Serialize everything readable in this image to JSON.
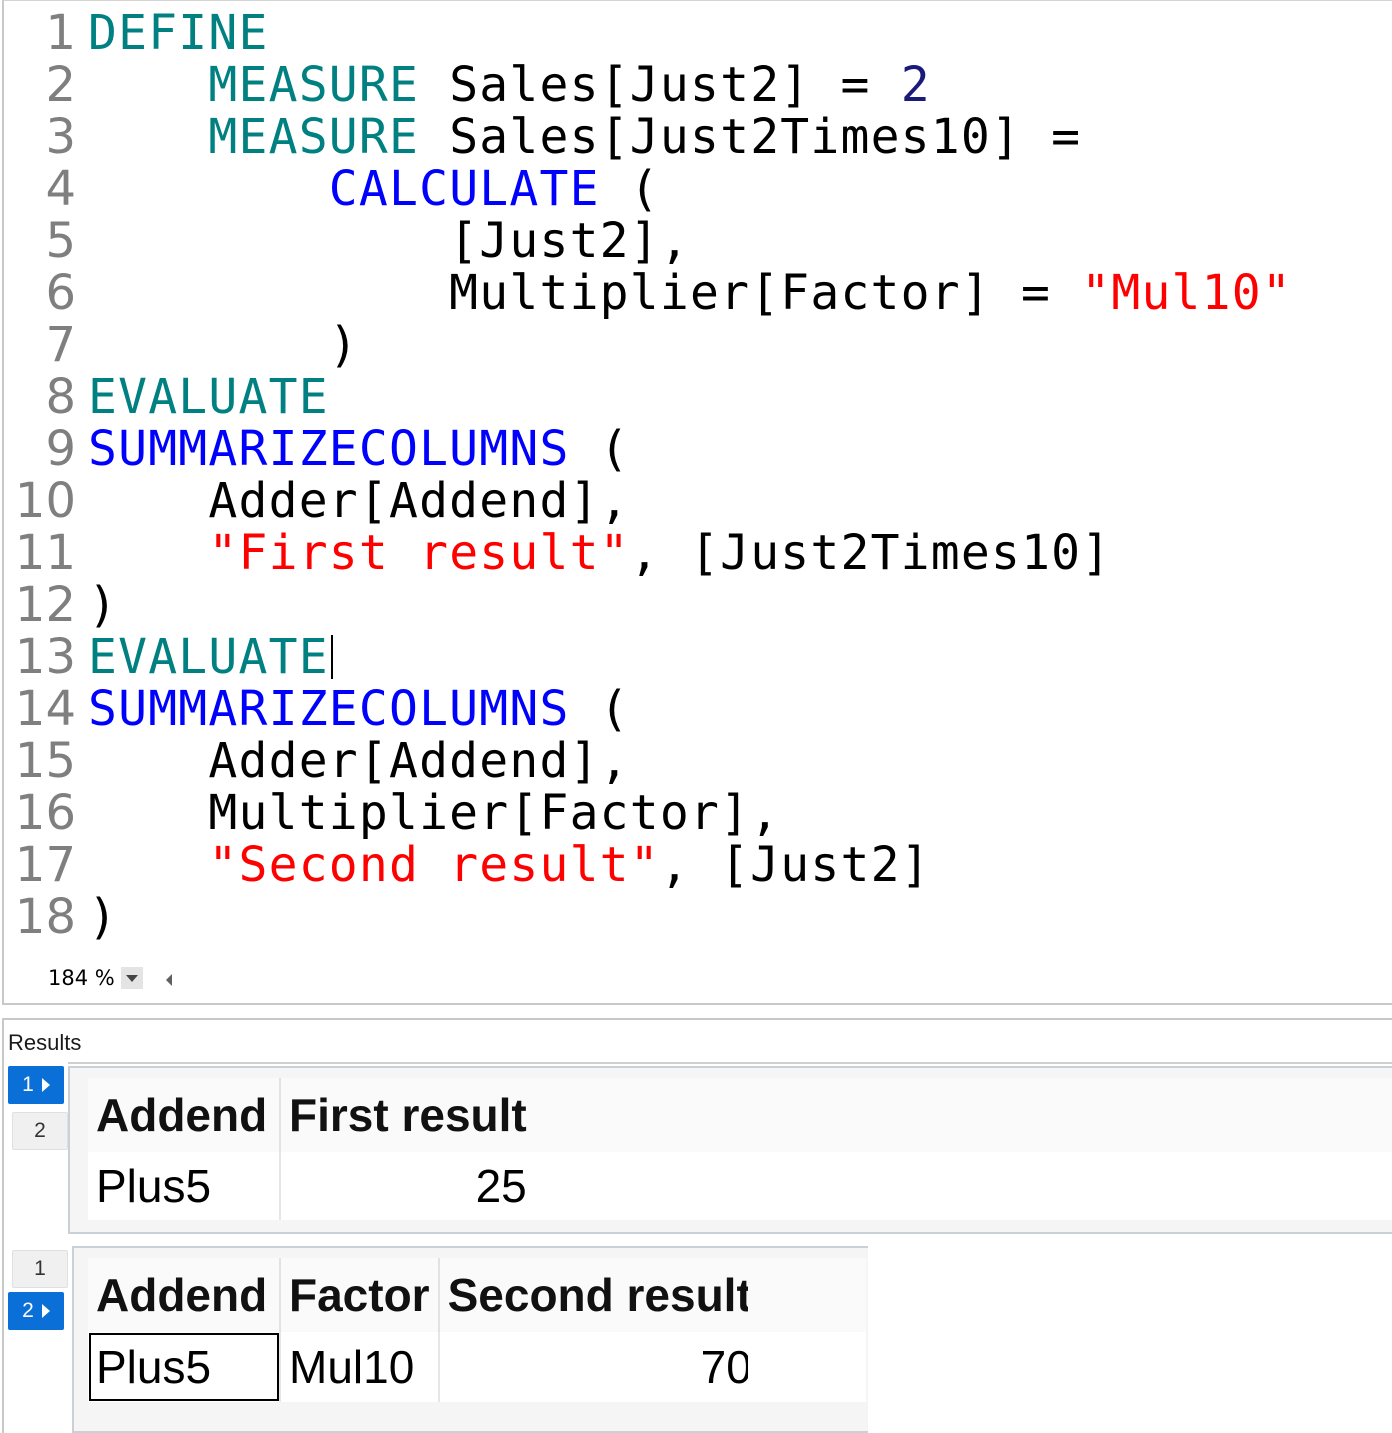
{
  "editor": {
    "lines": [
      {
        "n": "1",
        "tokens": [
          {
            "t": "DEFINE",
            "c": "kw-teal"
          }
        ]
      },
      {
        "n": "2",
        "tokens": [
          {
            "t": "    "
          },
          {
            "t": "MEASURE",
            "c": "kw-teal"
          },
          {
            "t": " Sales[Just2] = "
          },
          {
            "t": "2",
            "c": "num"
          }
        ]
      },
      {
        "n": "3",
        "tokens": [
          {
            "t": "    "
          },
          {
            "t": "MEASURE",
            "c": "kw-teal"
          },
          {
            "t": " Sales[Just2Times10] ="
          }
        ]
      },
      {
        "n": "4",
        "tokens": [
          {
            "t": "        "
          },
          {
            "t": "CALCULATE",
            "c": "kw-blue"
          },
          {
            "t": " ("
          }
        ]
      },
      {
        "n": "5",
        "tokens": [
          {
            "t": "            [Just2],"
          }
        ]
      },
      {
        "n": "6",
        "tokens": [
          {
            "t": "            Multiplier[Factor] = "
          },
          {
            "t": "\"Mul10\"",
            "c": "str"
          }
        ]
      },
      {
        "n": "7",
        "tokens": [
          {
            "t": "        )"
          }
        ]
      },
      {
        "n": "8",
        "tokens": [
          {
            "t": "EVALUATE",
            "c": "kw-teal"
          }
        ]
      },
      {
        "n": "9",
        "tokens": [
          {
            "t": "SUMMARIZECOLUMNS",
            "c": "kw-blue"
          },
          {
            "t": " ("
          }
        ]
      },
      {
        "n": "10",
        "tokens": [
          {
            "t": "    Adder[Addend],"
          }
        ]
      },
      {
        "n": "11",
        "tokens": [
          {
            "t": "    "
          },
          {
            "t": "\"First result\"",
            "c": "str"
          },
          {
            "t": ", [Just2Times10]"
          }
        ]
      },
      {
        "n": "12",
        "tokens": [
          {
            "t": ")"
          }
        ]
      },
      {
        "n": "13",
        "tokens": [
          {
            "t": "EVALUATE",
            "c": "kw-teal"
          }
        ],
        "caret": true
      },
      {
        "n": "14",
        "tokens": [
          {
            "t": "SUMMARIZECOLUMNS",
            "c": "kw-blue"
          },
          {
            "t": " ("
          }
        ]
      },
      {
        "n": "15",
        "tokens": [
          {
            "t": "    Adder[Addend],"
          }
        ]
      },
      {
        "n": "16",
        "tokens": [
          {
            "t": "    Multiplier[Factor],"
          }
        ]
      },
      {
        "n": "17",
        "tokens": [
          {
            "t": "    "
          },
          {
            "t": "\"Second result\"",
            "c": "str"
          },
          {
            "t": ", [Just2]"
          }
        ]
      },
      {
        "n": "18",
        "tokens": [
          {
            "t": ")"
          }
        ]
      }
    ],
    "zoom": "184 %"
  },
  "results": {
    "label": "Results",
    "result1": {
      "tabs": [
        {
          "label": "1",
          "active": true
        },
        {
          "label": "2",
          "active": false
        }
      ],
      "columns": [
        "Addend",
        "First result"
      ],
      "rows": [
        [
          "Plus5",
          "25"
        ]
      ]
    },
    "result2": {
      "tabs": [
        {
          "label": "1",
          "active": false
        },
        {
          "label": "2",
          "active": true
        }
      ],
      "columns": [
        "Addend",
        "Factor",
        "Second result"
      ],
      "rows": [
        [
          "Plus5",
          "Mul10",
          "70"
        ]
      ]
    }
  },
  "colors": {
    "keyword_teal": "#008080",
    "keyword_blue": "#0000ff",
    "string_red": "#ff0000",
    "line_number_gray": "#7f7f7f",
    "active_tab_blue": "#0a6fd6"
  },
  "icons": [
    "dropdown-arrow-icon",
    "scroll-left-icon",
    "tab-pointer-icon"
  ]
}
